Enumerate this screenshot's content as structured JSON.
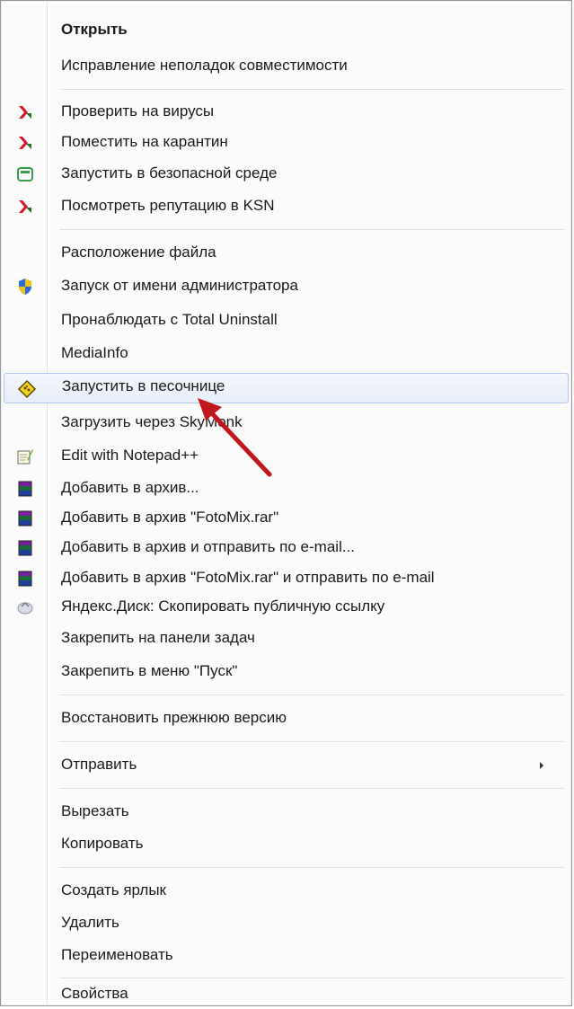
{
  "menu": {
    "items": [
      {
        "label": "Открыть",
        "bold": true,
        "icon": ""
      },
      {
        "label": "Исправление неполадок совместимости",
        "icon": ""
      },
      {
        "label": "Проверить на вирусы",
        "icon": "kaspersky-icon"
      },
      {
        "label": "Поместить на карантин",
        "icon": "kaspersky-icon"
      },
      {
        "label": "Запустить в безопасной среде",
        "icon": "safe-run-icon"
      },
      {
        "label": "Посмотреть репутацию в KSN",
        "icon": "kaspersky-icon"
      },
      {
        "label": "Расположение файла",
        "icon": ""
      },
      {
        "label": "Запуск от имени администратора",
        "icon": "uac-shield-icon"
      },
      {
        "label": "Пронаблюдать с Total Uninstall",
        "icon": ""
      },
      {
        "label": "MediaInfo",
        "icon": ""
      },
      {
        "label": "Запустить в песочнице",
        "icon": "sandboxie-icon",
        "hover": true
      },
      {
        "label": "Загрузить через SkyMonk",
        "icon": ""
      },
      {
        "label": "Edit with Notepad++",
        "icon": "notepadpp-icon"
      },
      {
        "label": "Добавить в архив...",
        "icon": "winrar-icon"
      },
      {
        "label": "Добавить в архив \"FotoMix.rar\"",
        "icon": "winrar-icon"
      },
      {
        "label": "Добавить в архив и отправить по e-mail...",
        "icon": "winrar-icon"
      },
      {
        "label": "Добавить в архив \"FotoMix.rar\" и отправить по e-mail",
        "icon": "winrar-icon"
      },
      {
        "label": "Яндекс.Диск: Скопировать публичную ссылку",
        "icon": "yandex-disk-icon"
      },
      {
        "label": "Закрепить на панели задач",
        "icon": ""
      },
      {
        "label": "Закрепить в меню \"Пуск\"",
        "icon": ""
      },
      {
        "label": "Восстановить прежнюю версию",
        "icon": ""
      },
      {
        "label": "Отправить",
        "icon": "",
        "submenu": true
      },
      {
        "label": "Вырезать",
        "icon": ""
      },
      {
        "label": "Копировать",
        "icon": ""
      },
      {
        "label": "Создать ярлык",
        "icon": ""
      },
      {
        "label": "Удалить",
        "icon": ""
      },
      {
        "label": "Переименовать",
        "icon": ""
      },
      {
        "label": "Свойства",
        "icon": ""
      }
    ]
  },
  "colors": {
    "hover_border": "#aec7ea",
    "annotation_arrow": "#c0161c"
  }
}
